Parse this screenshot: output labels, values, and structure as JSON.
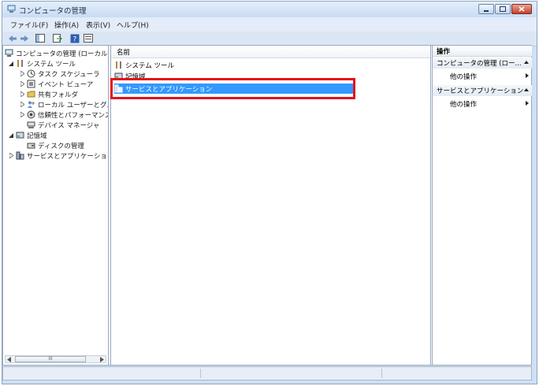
{
  "window": {
    "title": "コンピュータの管理"
  },
  "menu": [
    "ファイル(F)",
    "操作(A)",
    "表示(V)",
    "ヘルプ(H)"
  ],
  "toolbar": [
    "back-icon",
    "forward-icon",
    "show-tree-icon",
    "export-icon",
    "help-icon",
    "properties-icon"
  ],
  "tree": [
    {
      "label": "コンピュータの管理 (ローカル)",
      "level": 0,
      "expanded": true,
      "icon": "computer-icon"
    },
    {
      "label": "システム ツール",
      "level": 1,
      "expanded": true,
      "icon": "tools-icon"
    },
    {
      "label": "タスク スケジューラ",
      "level": 2,
      "expanded": false,
      "icon": "clock-icon"
    },
    {
      "label": "イベント ビューア",
      "level": 2,
      "expanded": false,
      "icon": "event-icon"
    },
    {
      "label": "共有フォルダ",
      "level": 2,
      "expanded": false,
      "icon": "folder-icon"
    },
    {
      "label": "ローカル ユーザーとグループ",
      "level": 2,
      "expanded": false,
      "icon": "users-icon"
    },
    {
      "label": "信頼性とパフォーマンス",
      "level": 2,
      "expanded": false,
      "icon": "performance-icon"
    },
    {
      "label": "デバイス マネージャ",
      "level": 2,
      "expanded": null,
      "icon": "device-icon"
    },
    {
      "label": "記憶域",
      "level": 1,
      "expanded": true,
      "icon": "storage-icon"
    },
    {
      "label": "ディスクの管理",
      "level": 2,
      "expanded": null,
      "icon": "disk-icon"
    },
    {
      "label": "サービスとアプリケーション",
      "level": 1,
      "expanded": false,
      "icon": "services-icon"
    }
  ],
  "scrollbar": {
    "thumb_label": "III"
  },
  "list": {
    "column": "名前",
    "items": [
      {
        "label": "システム ツール",
        "icon": "tools-icon",
        "selected": false
      },
      {
        "label": "記憶域",
        "icon": "storage-icon",
        "selected": false
      },
      {
        "label": "サービスとアプリケーション",
        "icon": "services-icon",
        "selected": true
      }
    ]
  },
  "actions": {
    "header": "操作",
    "sections": [
      {
        "title": "コンピュータの管理 (ロー...",
        "item": "他の操作"
      },
      {
        "title": "サービスとアプリケーション",
        "item": "他の操作"
      }
    ]
  },
  "colors": {
    "selection": "#3399ff",
    "highlight_box": "#e3121b"
  }
}
